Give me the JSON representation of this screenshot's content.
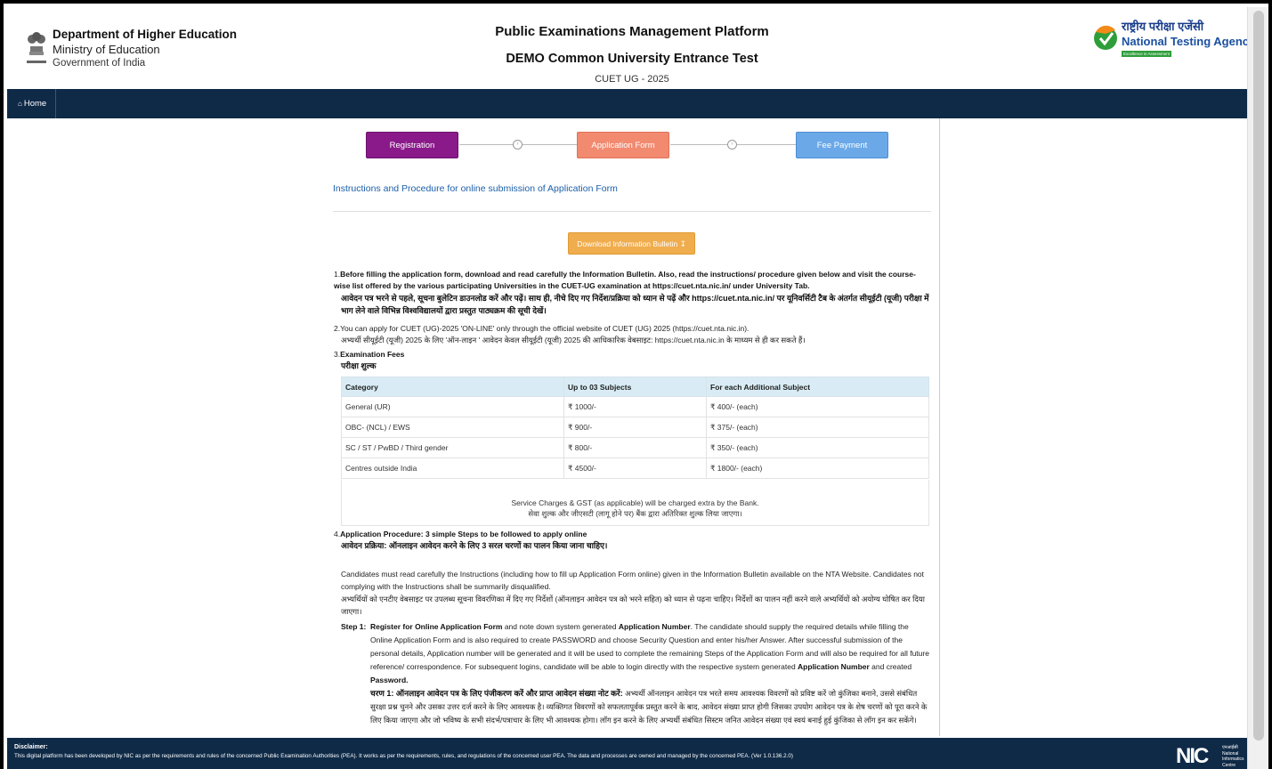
{
  "header": {
    "dept_name": "Department of Higher Education",
    "ministry": "Ministry of Education",
    "government": "Government of India",
    "emblem_icon": "national-emblem-icon",
    "platform_title": "Public Examinations Management Platform",
    "exam_title": "DEMO Common University Entrance Test",
    "exam_code": "CUET UG - 2025",
    "nta_hindi": "राष्ट्रीय परीक्षा एजेंसी",
    "nta_english": "National Testing Agency",
    "nta_tagline": "Excellence in Assessment"
  },
  "nav": {
    "home_label": "Home",
    "home_icon": "home-icon",
    "bg_color": "#0e2a47"
  },
  "steps": {
    "registration": "Registration",
    "application_form": "Application Form",
    "fee_payment": "Fee Payment",
    "registration_color": "#8a1a8a",
    "application_color": "#f28a70",
    "fee_color": "#6aa8e8"
  },
  "instructions": {
    "title": "Instructions and Procedure for online submission of Application Form",
    "download_label": "Download Information Bulletin",
    "download_icon": "download-icon",
    "p1_num": "1.",
    "p1_en": "Before filling the application form, download and read carefully the Information Bulletin. Also, read the instructions/ procedure given below and visit the course-wise list offered by the various participating Universities in the CUET-UG examination at https://cuet.nta.nic.in/  under University Tab.",
    "p1_hi": "आवेदन पत्र भरने से पहले, सूचना बुलेटिन डाउनलोड करें और पढ़ें। साथ ही, नीचे दिए गए निर्देश/प्रक्रिया को ध्यान से पढ़ें और https://cuet.nta.nic.in/ पर यूनिवर्सिटी टैब के अंतर्गत सीयूईटी (यूजी) परीक्षा में भाग लेने वाले विभिन्न विश्वविद्यालयों द्वारा प्रस्तुत पाठ्यक्रम की सूची देखें।",
    "p2_en": "2.You can apply for CUET (UG)-2025 'ON-LINE' only through the official website of CUET (UG) 2025 (https://cuet.nta.nic.in).",
    "p2_hi": "अभ्यर्थी सीयूईटी (यूजी) 2025 के लिए 'ऑन-लाइन ' आवेदन केवल सीयूईटी (यूजी) 2025 की आधिकारिक वेबसाइट: https://cuet.nta.nic.in के माध्यम से ही कर सकते हैं।",
    "p3_num": "3.",
    "p3_en": "Examination Fees",
    "p3_hi": "परीक्षा शुल्क",
    "fee_table": {
      "headers": [
        "Category",
        "Up to 03 Subjects",
        "For each Additional Subject"
      ],
      "rows": [
        [
          "General (UR)",
          "₹ 1000/-",
          "₹ 400/- (each)"
        ],
        [
          "OBC- (NCL) / EWS",
          "₹ 900/-",
          "₹ 375/- (each)"
        ],
        [
          "SC / ST / PwBD / Third gender",
          "₹ 800/-",
          "₹ 350/- (each)"
        ],
        [
          "Centres outside India",
          "₹ 4500/-",
          "₹ 1800/- (each)"
        ]
      ],
      "note_en": "Service Charges & GST (as applicable) will be charged extra by the Bank.",
      "note_hi": "सेवा शुल्क और जीएसटी (लागू होने पर) बैंक द्वारा अतिरिक्त शुल्क लिया जाएगा।"
    },
    "p4_num": "4.",
    "p4_en": "Application Procedure: 3 simple Steps to be followed to apply online",
    "p4_hi": "आवेदन प्रक्रिया: ऑनलाइन आवेदन करने के लिए 3 सरल चरणों का पालन किया जाना चाहिए।",
    "candidates_en": "Candidates must read carefully the Instructions (including how to fill up Application Form online) given in the Information Bulletin available on the NTA Website. Candidates not complying with the Instructions shall be summarily disqualified.",
    "candidates_hi": "अभ्यर्थियों को एनटीए वेबसाइट पर उपलब्ध सूचना विवरणिका में दिए गए निर्देशों (ऑनलाइन आवेदन पत्र को भरने सहित) को ध्यान से पढ़ना चाहिए। निर्देशों का पालन नहीं करने वाले अभ्यर्थियों को अयोग्य घोषित कर दिया जाएगा।",
    "step1_label": "Step 1:",
    "step1_lead": "Register for Online Application Form",
    "step1_mid1": " and note down system generated ",
    "step1_appnum": "Application Number",
    "step1_mid2": ". The candidate should supply the required details while filling the Online Application Form and is also required to create PASSWORD and choose Security Question and enter his/her Answer. After successful submission of the personal details, Application number will be generated and it will be used to complete the remaining Steps of the Application Form and will also be required for all future reference/ correspondence. For subsequent logins, candidate will be able to login directly with the respective system generated ",
    "step1_appnum2": "Application Number",
    "step1_mid3": " and created ",
    "step1_password": "Password.",
    "step1_hi_lead": "चरण 1: ऑनलाइन आवेदन पत्र के लिए पंजीकरण करें और प्राप्त आवेदन संख्या नोट करें:",
    "step1_hi": " अभ्यर्थी ऑनलाइन आवेदन पत्र भरते समय आवश्यक विवरणों को प्रविष्ट करें जो कुंजिका बनाने, उससे संबंधित सुरक्षा प्रश्न चुनने और उसका उत्तर दर्ज करने के लिए आवश्यक है। व्यक्तिगत विवरणों को सफलतापूर्वक प्रस्तुत करने के बाद, आवेदन संख्या प्राप्त होगी जिसका उपयोग आवेदन पत्र के शेष चरणों को पूरा करने के लिए किया जाएगा और जो भविष्य के सभी संदर्भ/पत्राचार के लिए भी आवश्यक होगा। लॉग इन करने के लिए अभ्यर्थी संबंधित सिस्टम जनित आवेदन संख्या एवं स्वयं बनाई हुई कुंजिका से लॉग इन कर सकेंगे।"
  },
  "footer": {
    "disclaimer_label": "Disclaimer:",
    "disclaimer_text": "This digital platform has been developed by NIC as per the requirements and rules of the concerned Public Examination Authorities (PEA). It works as per the requirements, rules, and regulations of the concerned user PEA. The data and processes are owned and managed by the concerned PEA. (Ver 1.0.136.2.0)",
    "nic_logo": "NIC",
    "nic_hindi": "एनआईसी",
    "nic_sub1": "National",
    "nic_sub2": "Informatics",
    "nic_sub3": "Centre"
  }
}
